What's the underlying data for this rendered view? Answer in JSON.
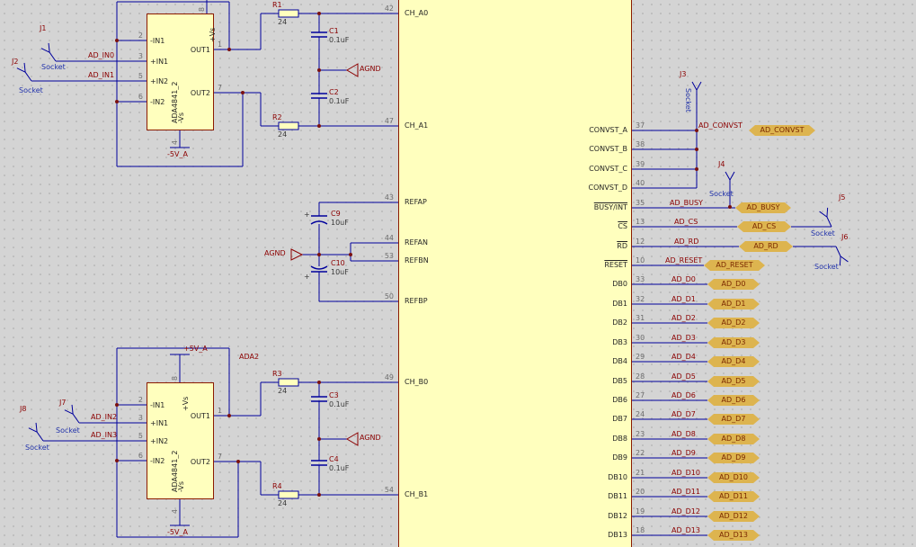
{
  "amp1": {
    "part": "ADA4841_2",
    "pins": [
      {
        "name": "-IN1",
        "num": "2"
      },
      {
        "name": "+IN1",
        "num": "3"
      },
      {
        "name": "+IN2",
        "num": "5"
      },
      {
        "name": "-IN2",
        "num": "6"
      },
      {
        "name": "OUT1",
        "num": "1"
      },
      {
        "name": "OUT2",
        "num": "7"
      },
      {
        "name": "+Vs",
        "num": "8"
      },
      {
        "name": "-Vs",
        "num": "4"
      }
    ]
  },
  "amp2": {
    "designator": "ADA2",
    "part": "ADA4841_2",
    "pins": [
      {
        "name": "-IN1",
        "num": "2"
      },
      {
        "name": "+IN1",
        "num": "3"
      },
      {
        "name": "+IN2",
        "num": "5"
      },
      {
        "name": "-IN2",
        "num": "6"
      },
      {
        "name": "OUT1",
        "num": "1"
      },
      {
        "name": "OUT2",
        "num": "7"
      },
      {
        "name": "+Vs",
        "num": "8"
      },
      {
        "name": "-Vs",
        "num": "4"
      }
    ]
  },
  "connectors": [
    {
      "ref": "J1",
      "type": "Socket"
    },
    {
      "ref": "J2",
      "type": "Socket"
    },
    {
      "ref": "J3",
      "type": "Socket"
    },
    {
      "ref": "J4",
      "type": "Socket"
    },
    {
      "ref": "J5",
      "type": "Socket"
    },
    {
      "ref": "J6",
      "type": "Socket"
    },
    {
      "ref": "J7",
      "type": "Socket"
    },
    {
      "ref": "J8",
      "type": "Socket"
    }
  ],
  "resistors": [
    {
      "ref": "R1",
      "value": "24"
    },
    {
      "ref": "R2",
      "value": "24"
    },
    {
      "ref": "R3",
      "value": "24"
    },
    {
      "ref": "R4",
      "value": "24"
    }
  ],
  "capacitors": [
    {
      "ref": "C1",
      "value": "0.1uF"
    },
    {
      "ref": "C2",
      "value": "0.1uF"
    },
    {
      "ref": "C3",
      "value": "0.1uF"
    },
    {
      "ref": "C4",
      "value": "0.1uF"
    },
    {
      "ref": "C9",
      "value": "10uF",
      "polarity": "+"
    },
    {
      "ref": "C10",
      "value": "10uF",
      "polarity": "+"
    }
  ],
  "power": {
    "agnd": "AGND",
    "pos": "+5V_A",
    "neg": "-5V_A"
  },
  "input_nets": [
    "AD_IN0",
    "AD_IN1",
    "AD_IN2",
    "AD_IN3"
  ],
  "main_ic": {
    "left_pins": [
      {
        "num": "42",
        "name": "CH_A0"
      },
      {
        "num": "47",
        "name": "CH_A1"
      },
      {
        "num": "43",
        "name": "REFAP"
      },
      {
        "num": "44",
        "name": "REFAN"
      },
      {
        "num": "53",
        "name": "REFBN"
      },
      {
        "num": "50",
        "name": "REFBP"
      },
      {
        "num": "49",
        "name": "CH_B0"
      },
      {
        "num": "54",
        "name": "CH_B1"
      }
    ],
    "right_pins": [
      {
        "num": "37",
        "name": "CONVST_A",
        "net": "AD_CONVST",
        "port": "AD_CONVST"
      },
      {
        "num": "38",
        "name": "CONVST_B"
      },
      {
        "num": "39",
        "name": "CONVST_C"
      },
      {
        "num": "40",
        "name": "CONVST_D"
      },
      {
        "num": "35",
        "name": "BUSY/INT",
        "overline": true,
        "net": "AD_BUSY",
        "port": "AD_BUSY"
      },
      {
        "num": "13",
        "name": "CS",
        "overline": true,
        "net": "AD_CS",
        "port": "AD_CS"
      },
      {
        "num": "12",
        "name": "RD",
        "overline": true,
        "net": "AD_RD",
        "port": "AD_RD"
      },
      {
        "num": "10",
        "name": "RESET",
        "overline": true,
        "net": "AD_RESET",
        "port": "AD_RESET"
      },
      {
        "num": "33",
        "name": "DB0",
        "net": "AD_D0",
        "port": "AD_D0"
      },
      {
        "num": "32",
        "name": "DB1",
        "net": "AD_D1",
        "port": "AD_D1"
      },
      {
        "num": "31",
        "name": "DB2",
        "net": "AD_D2",
        "port": "AD_D2"
      },
      {
        "num": "30",
        "name": "DB3",
        "net": "AD_D3",
        "port": "AD_D3"
      },
      {
        "num": "29",
        "name": "DB4",
        "net": "AD_D4",
        "port": "AD_D4"
      },
      {
        "num": "28",
        "name": "DB5",
        "net": "AD_D5",
        "port": "AD_D5"
      },
      {
        "num": "27",
        "name": "DB6",
        "net": "AD_D6",
        "port": "AD_D6"
      },
      {
        "num": "24",
        "name": "DB7",
        "net": "AD_D7",
        "port": "AD_D7"
      },
      {
        "num": "23",
        "name": "DB8",
        "net": "AD_D8",
        "port": "AD_D8"
      },
      {
        "num": "22",
        "name": "DB9",
        "net": "AD_D9",
        "port": "AD_D9"
      },
      {
        "num": "21",
        "name": "DB10",
        "net": "AD_D10",
        "port": "AD_D10"
      },
      {
        "num": "20",
        "name": "DB11",
        "net": "AD_D11",
        "port": "AD_D11"
      },
      {
        "num": "19",
        "name": "DB12",
        "net": "AD_D12",
        "port": "AD_D12"
      },
      {
        "num": "18",
        "name": "DB13",
        "net": "AD_D13",
        "port": "AD_D13"
      }
    ]
  }
}
